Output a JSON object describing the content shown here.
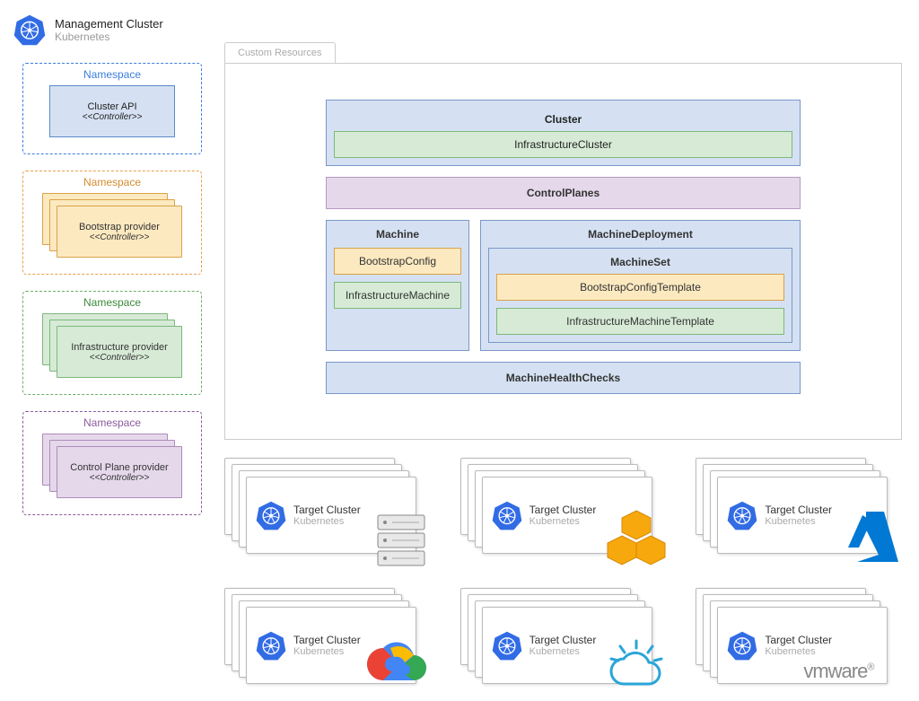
{
  "header": {
    "title": "Management Cluster",
    "subtitle": "Kubernetes"
  },
  "namespaces": [
    {
      "label": "Namespace",
      "color": "blue",
      "card_title": "Cluster API",
      "card_stereotype": "<<Controller>>"
    },
    {
      "label": "Namespace",
      "color": "orange",
      "card_title": "Bootstrap provider",
      "card_stereotype": "<<Controller>>"
    },
    {
      "label": "Namespace",
      "color": "green",
      "card_title": "Infrastructure provider",
      "card_stereotype": "<<Controller>>"
    },
    {
      "label": "Namespace",
      "color": "purple",
      "card_title": "Control Plane provider",
      "card_stereotype": "<<Controller>>"
    }
  ],
  "main": {
    "tab": "Custom Resources",
    "cluster": {
      "title": "Cluster",
      "child": "InfrastructureCluster"
    },
    "controlplanes": "ControlPlanes",
    "machine": {
      "title": "Machine",
      "bootstrap": "BootstrapConfig",
      "infra": "InfrastructureMachine"
    },
    "machine_deployment": {
      "title": "MachineDeployment",
      "machine_set": {
        "title": "MachineSet",
        "bootstrap_template": "BootstrapConfigTemplate",
        "infra_template": "InfrastructureMachineTemplate"
      }
    },
    "mhc": "MachineHealthChecks"
  },
  "target_clusters": [
    {
      "title": "Target Cluster",
      "subtitle": "Kubernetes",
      "provider": "baremetal"
    },
    {
      "title": "Target Cluster",
      "subtitle": "Kubernetes",
      "provider": "aws"
    },
    {
      "title": "Target Cluster",
      "subtitle": "Kubernetes",
      "provider": "azure"
    },
    {
      "title": "Target Cluster",
      "subtitle": "Kubernetes",
      "provider": "gcp"
    },
    {
      "title": "Target Cluster",
      "subtitle": "Kubernetes",
      "provider": "ibm"
    },
    {
      "title": "Target Cluster",
      "subtitle": "Kubernetes",
      "provider": "vmware"
    }
  ],
  "icons": {
    "k8s": "kubernetes-wheel",
    "providers": {
      "baremetal": "server-rack",
      "aws": "cubes",
      "azure": "azure-triangle",
      "gcp": "google-cloud",
      "ibm": "cloud-sun",
      "vmware": "vmware-text"
    }
  }
}
